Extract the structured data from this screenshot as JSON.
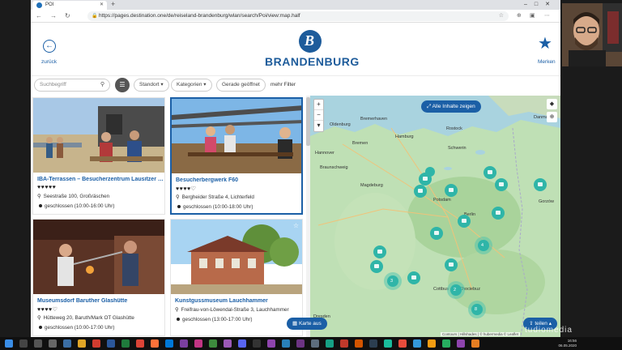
{
  "browser": {
    "tab_title": "POI",
    "url": "https://pages.destination.one/de/reiseland-brandenburg/wlan/search/Poi/view:map.half"
  },
  "header": {
    "back_label": "zurück",
    "logo_text": "BRANDENBURG",
    "merken_label": "Merken"
  },
  "filters": {
    "search_placeholder": "Suchbegriff",
    "standort": "Standort",
    "kategorien": "Kategorien",
    "open_now": "Gerade geöffnet",
    "more": "mehr Filter"
  },
  "cards": [
    {
      "title": "IBA-Terrassen – Besucherzentrum Lausitzer S...",
      "hearts": "♥♥♥♥♥",
      "address": "Seestraße 100, Großräschen",
      "status": "geschlossen (10:00-16:00 Uhr)"
    },
    {
      "title": "Besucherbergwerk F60",
      "hearts": "♥♥♥♥♡",
      "address": "Bergheider Straße 4, Lichterfeld",
      "status": "geschlossen (10:00-18:00 Uhr)"
    },
    {
      "title": "Museumsdorf Baruther Glashütte",
      "hearts": "♥♥♥♥♡",
      "address": "Hütteweg 20, Baruth/Mark OT Glashütte",
      "status": "geschlossen (10:00-17:00 Uhr)"
    },
    {
      "title": "Kunstgussmuseum Lauchhammer",
      "hearts": "",
      "address": "Freifrau-von-Löwendal-Straße 3, Lauchhammer",
      "status": "geschlossen (13:00-17:00 Uhr)"
    }
  ],
  "map": {
    "alle_label": "Alle Inhalte zeigen",
    "karte_label": "Karte aus",
    "teilen_label": "teilen",
    "attribution": "Contours | Hillshades | © hubermedia © Leaflet",
    "cities": [
      "Oldenburg",
      "Bremerhaven",
      "Hamburg",
      "Rostock",
      "Bremen",
      "Danmark",
      "Schwerin",
      "Hannover",
      "Braunschweig",
      "Magdeburg",
      "Potsdam",
      "Berlin",
      "Cottbus",
      "Dresden",
      "Chociebuz",
      "Gorzów"
    ],
    "cluster_counts": [
      "4",
      "3",
      "2",
      "8"
    ]
  },
  "taskbar": {
    "time": "16:56",
    "date": "06.05.2020"
  },
  "watermark": "tudiomedia"
}
